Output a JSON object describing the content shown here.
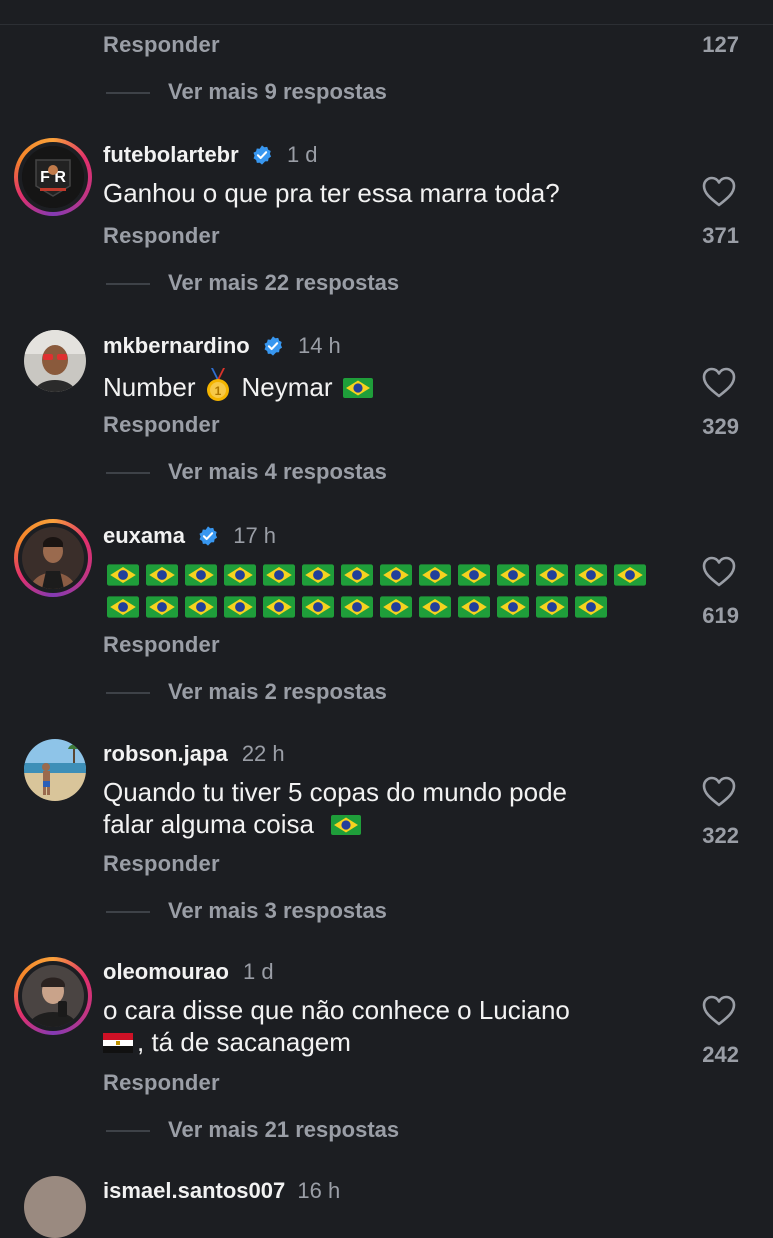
{
  "top": {
    "reply_label": "Responder",
    "like_count": "127",
    "more_replies": "Ver mais 9 respostas"
  },
  "comments": [
    {
      "username": "futebolartebr",
      "time": "1 d",
      "verified": true,
      "text_line1": "Ganhou o que pra ter essa marra toda?",
      "reply_label": "Responder",
      "like_count": "371",
      "more_replies": "Ver mais 22 respostas"
    },
    {
      "username": "mkbernardino",
      "time": "14 h",
      "verified": true,
      "text_part1": "Number",
      "text_part2": "Neymar",
      "emoji_1": "1st-place-medal",
      "emoji_2": "brazil-flag",
      "reply_label": "Responder",
      "like_count": "329",
      "more_replies": "Ver mais 4 respostas"
    },
    {
      "username": "euxama",
      "time": "17 h",
      "verified": true,
      "flag_emoji": "brazil-flag",
      "flags_row1_count": 14,
      "flags_row2_count": 13,
      "reply_label": "Responder",
      "like_count": "619",
      "more_replies": "Ver mais 2 respostas"
    },
    {
      "username": "robson.japa",
      "time": "22 h",
      "verified": false,
      "text_line1": "Quando tu tiver 5 copas do mundo pode",
      "text_line2": "falar alguma coisa",
      "emoji": "brazil-flag",
      "reply_label": "Responder",
      "like_count": "322",
      "more_replies": "Ver mais 3 respostas"
    },
    {
      "username": "oleomourao",
      "time": "1 d",
      "verified": false,
      "text_line1": "o cara disse que não conhece o Luciano",
      "text_line2": ", tá de sacanagem",
      "emoji": "egypt-flag",
      "reply_label": "Responder",
      "like_count": "242",
      "more_replies": "Ver mais 21 respostas"
    }
  ],
  "partial_next": {
    "username": "ismael.santos007",
    "time": "16 h"
  },
  "colors": {
    "background": "#1c1e22",
    "text": "#f2f2f2",
    "muted": "#9a9ea6",
    "verified_blue": "#3897f0"
  }
}
